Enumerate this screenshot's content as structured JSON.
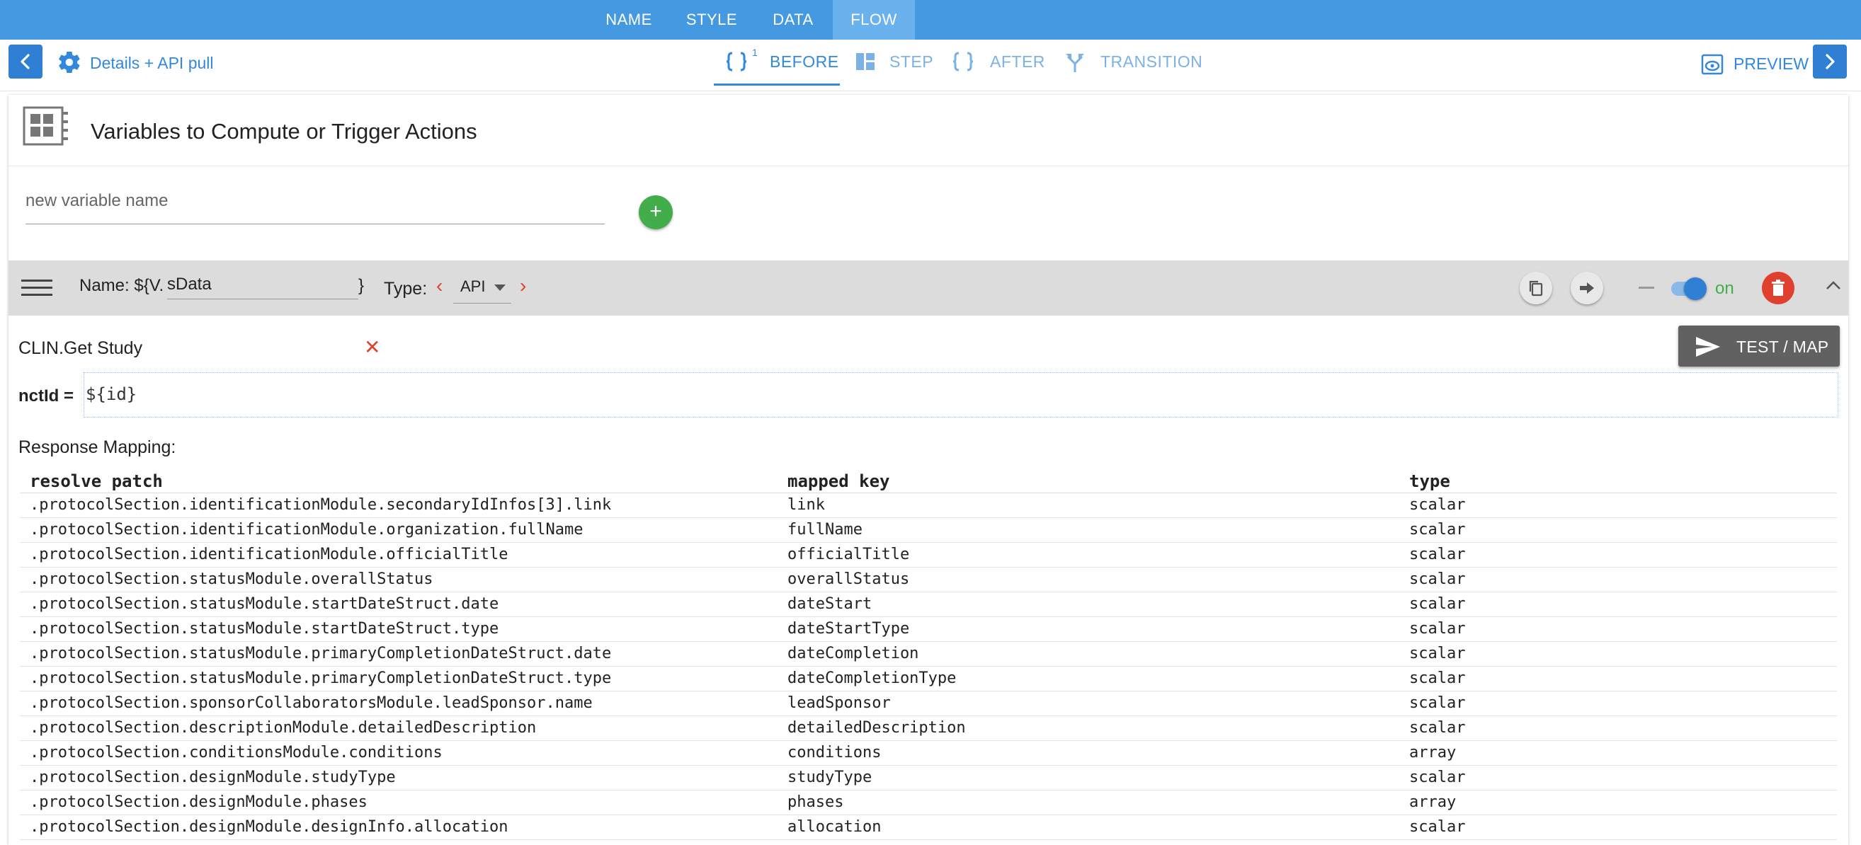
{
  "top_tabs": [
    {
      "label": "NAME"
    },
    {
      "label": "STYLE"
    },
    {
      "label": "DATA"
    },
    {
      "label": "FLOW"
    }
  ],
  "subbar": {
    "step_title": "Details + API pull",
    "flow_tabs": [
      {
        "label": "BEFORE",
        "badge": "1"
      },
      {
        "label": "STEP"
      },
      {
        "label": "AFTER"
      },
      {
        "label": "TRANSITION"
      }
    ],
    "preview_label": "PREVIEW"
  },
  "card": {
    "title": "Variables to Compute or Trigger Actions",
    "new_variable_placeholder": "new variable name",
    "add_symbol": "+"
  },
  "variable": {
    "name_prefix": "Name: ${V.",
    "name_value": "sData",
    "name_suffix": "}",
    "type_label": "Type:",
    "type_value": "API",
    "toggle_label": "on"
  },
  "api": {
    "name": "CLIN.Get Study",
    "test_button": "TEST / MAP",
    "param_label": "nctId =",
    "param_value": "${id}",
    "response_mapping_label": "Response Mapping:"
  },
  "mapping_table": {
    "headers": [
      "resolve patch",
      "mapped key",
      "type"
    ],
    "rows": [
      [
        ".protocolSection.identificationModule.secondaryIdInfos[3].link",
        "link",
        "scalar"
      ],
      [
        ".protocolSection.identificationModule.organization.fullName",
        "fullName",
        "scalar"
      ],
      [
        ".protocolSection.identificationModule.officialTitle",
        "officialTitle",
        "scalar"
      ],
      [
        ".protocolSection.statusModule.overallStatus",
        "overallStatus",
        "scalar"
      ],
      [
        ".protocolSection.statusModule.startDateStruct.date",
        "dateStart",
        "scalar"
      ],
      [
        ".protocolSection.statusModule.startDateStruct.type",
        "dateStartType",
        "scalar"
      ],
      [
        ".protocolSection.statusModule.primaryCompletionDateStruct.date",
        "dateCompletion",
        "scalar"
      ],
      [
        ".protocolSection.statusModule.primaryCompletionDateStruct.type",
        "dateCompletionType",
        "scalar"
      ],
      [
        ".protocolSection.sponsorCollaboratorsModule.leadSponsor.name",
        "leadSponsor",
        "scalar"
      ],
      [
        ".protocolSection.descriptionModule.detailedDescription",
        "detailedDescription",
        "scalar"
      ],
      [
        ".protocolSection.conditionsModule.conditions",
        "conditions",
        "array"
      ],
      [
        ".protocolSection.designModule.studyType",
        "studyType",
        "scalar"
      ],
      [
        ".protocolSection.designModule.phases",
        "phases",
        "array"
      ],
      [
        ".protocolSection.designModule.designInfo.allocation",
        "allocation",
        "scalar"
      ]
    ]
  },
  "colors": {
    "primary": "#4499e0",
    "accent": "#2f7fd5",
    "add": "#43ad4b",
    "danger": "#e0412f"
  }
}
